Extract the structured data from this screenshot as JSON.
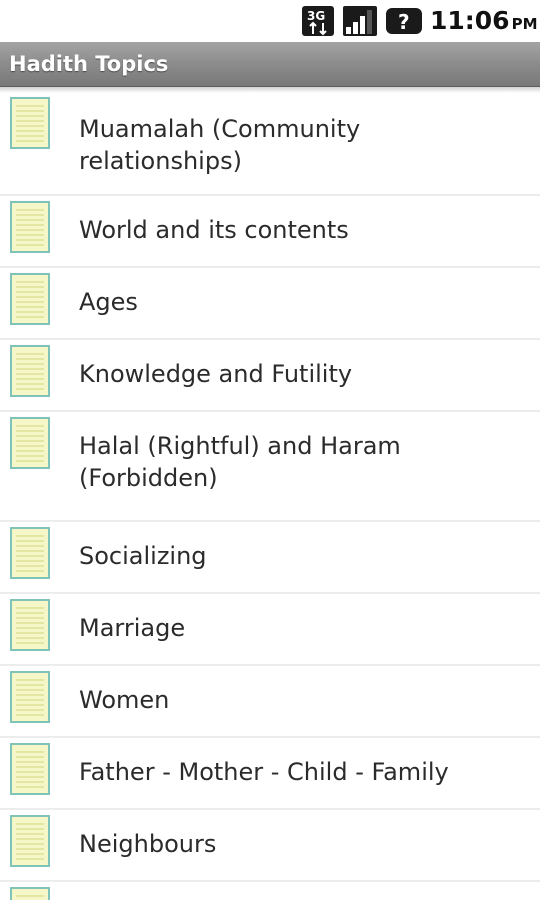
{
  "status_bar": {
    "icons": [
      "3g-data-icon",
      "signal-strength-icon",
      "help-icon"
    ],
    "time": "11:06",
    "ampm": "PM"
  },
  "header": {
    "title": "Hadith Topics"
  },
  "colors": {
    "title_bar": "#8e8e8e",
    "title_text": "#ffffff",
    "list_text": "#2b2b2b",
    "doc_icon_fill": "#f6f7c8",
    "doc_icon_border": "#7fc4b6",
    "divider": "#ececec"
  },
  "topics": [
    {
      "label": "Muamalah (Community relationships)",
      "icon": "document-icon"
    },
    {
      "label": "World and its contents",
      "icon": "document-icon"
    },
    {
      "label": "Ages",
      "icon": "document-icon"
    },
    {
      "label": "Knowledge and Futility",
      "icon": "document-icon"
    },
    {
      "label": "Halal (Rightful) and Haram (Forbidden)",
      "icon": "document-icon"
    },
    {
      "label": "Socializing",
      "icon": "document-icon"
    },
    {
      "label": "Marriage",
      "icon": "document-icon"
    },
    {
      "label": "Women",
      "icon": "document-icon"
    },
    {
      "label": "Father - Mother - Child - Family",
      "icon": "document-icon"
    },
    {
      "label": "Neighbours",
      "icon": "document-icon"
    }
  ]
}
